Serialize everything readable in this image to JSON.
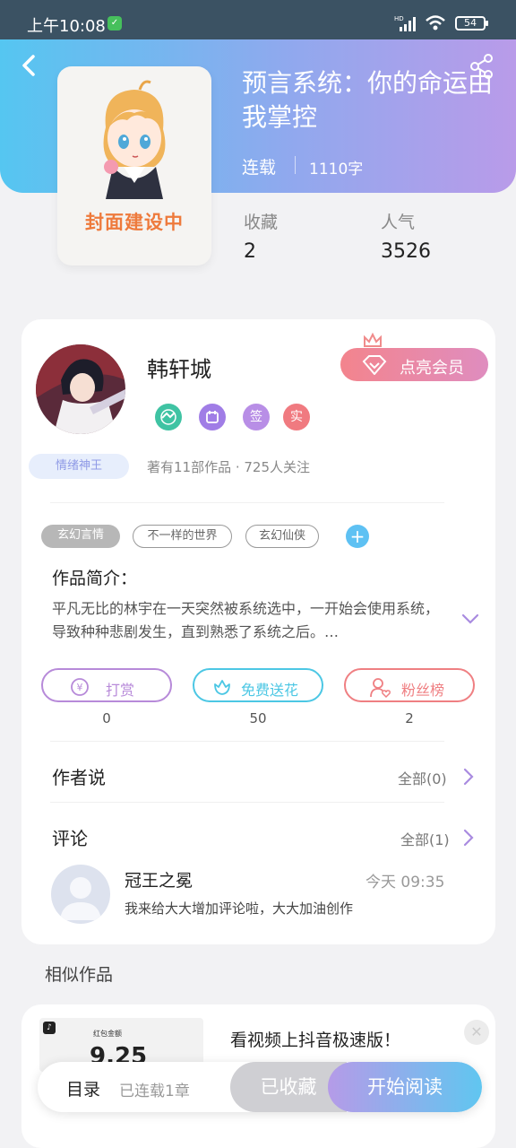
{
  "status_bar": {
    "time": "上午10:08",
    "battery": "54",
    "net_badge": "HD"
  },
  "book": {
    "title": "预言系统：你的命运由我掌控",
    "status": "连载",
    "word_count": "1110字",
    "cover_text": "封面建设中",
    "collect_label": "收藏",
    "collect_value": "2",
    "popularity_label": "人气",
    "popularity_value": "3526"
  },
  "author": {
    "name": "韩轩城",
    "vip_label": "点亮会员",
    "badges": [
      "签",
      "实"
    ],
    "level": "情绪神王",
    "meta": "著有11部作品 · 725人关注"
  },
  "tags": [
    "玄幻言情",
    "不一样的世界",
    "玄幻仙侠"
  ],
  "intro": {
    "title": "作品简介：",
    "text": "平凡无比的林宇在一天突然被系统选中，一开始会使用系统，导致种种悲剧发生，直到熟悉了系统之后。…"
  },
  "actions": [
    {
      "label": "打赏",
      "count": "0",
      "color": "#b78ad9"
    },
    {
      "label": "免费送花",
      "count": "50",
      "color": "#4cc7e4"
    },
    {
      "label": "粉丝榜",
      "count": "2",
      "color": "#ef7f82"
    }
  ],
  "author_says": {
    "title": "作者说",
    "link": "全部(0)"
  },
  "comments": {
    "title": "评论",
    "link": "全部(1)",
    "items": [
      {
        "user": "冠王之冕",
        "time": "今天 09:35",
        "text": "我来给大大增加评论啦，大大加油创作"
      }
    ]
  },
  "similar": {
    "title": "相似作品",
    "ad_text": "看视频上抖音极速版！",
    "ad_thumb_label": "红包金额",
    "ad_thumb_value": "9.25"
  },
  "bottom": {
    "toc": "目录",
    "chapters": "已连载1章",
    "collected": "已收藏",
    "read": "开始阅读"
  },
  "colors": {
    "accent_purple": "#b59be8",
    "accent_blue": "#55c6f1",
    "vip_pink": "#f3848d"
  }
}
